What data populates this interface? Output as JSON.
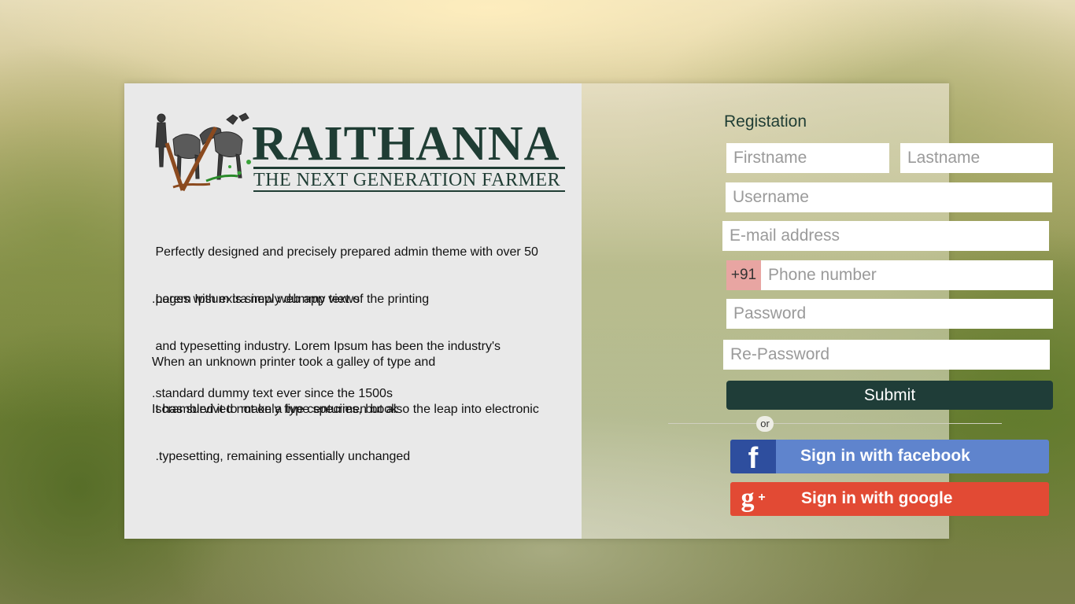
{
  "brand": {
    "name": "RAITHANNA",
    "tagline": "THE NEXT GENERATION FARMER"
  },
  "info": {
    "p1_l1": " Perfectly designed and precisely prepared admin theme with over 50",
    "p1_l2": ".pages with extra new web app views",
    "p2_l1": " Lorem Ipsum is simply dummy text of the printing",
    "p2_l2": " and typesetting industry. Lorem Ipsum has been the industry's",
    "p2_l3": ".standard dummy text ever since the 1500s",
    "p3_l1": "When an unknown printer took a galley of type and",
    "p3_l2": ".scrambled it to make a type specimen book",
    "p4_l1": "It has survived not only five centuries, but also the leap into electronic",
    "p4_l2": " .typesetting, remaining essentially unchanged"
  },
  "form": {
    "title": "Registation",
    "firstname_placeholder": "Firstname",
    "lastname_placeholder": "Lastname",
    "username_placeholder": "Username",
    "email_placeholder": "E-mail address",
    "phone_prefix": "+91",
    "phone_placeholder": "Phone number",
    "password_placeholder": "Password",
    "repassword_placeholder": "Re-Password",
    "submit_label": "Submit",
    "or_label": "or",
    "facebook_label": "Sign in with facebook",
    "google_label": "Sign in with google"
  },
  "colors": {
    "brand_dark_green": "#1f3d34",
    "facebook_blue": "#5f84cd",
    "facebook_icon_bg": "#2e4e9e",
    "google_red": "#e24a34",
    "phone_prefix_bg": "#e8a5a2"
  },
  "icons": {
    "logo": "farmer-with-bullocks-plough-logo",
    "facebook": "facebook-f-icon",
    "google": "google-plus-icon"
  }
}
